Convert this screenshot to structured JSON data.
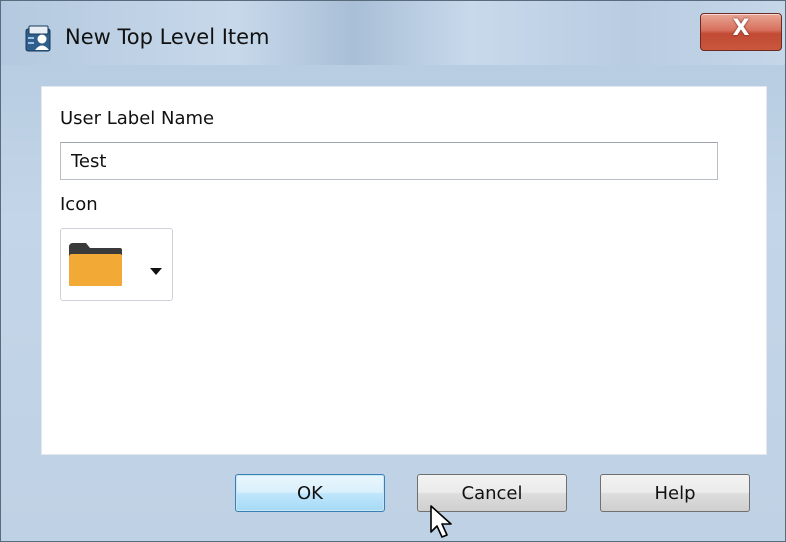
{
  "window": {
    "title": "New Top Level Item",
    "close_glyph": "X"
  },
  "form": {
    "user_label_name": {
      "label": "User Label Name",
      "value": "Test"
    },
    "icon": {
      "label": "Icon",
      "selected_icon": "folder-icon",
      "folder_color": "#f3a935"
    }
  },
  "buttons": {
    "ok": "OK",
    "cancel": "Cancel",
    "help": "Help"
  },
  "colors": {
    "close_button": "#c9573d",
    "default_button": "#a7d9f5"
  }
}
